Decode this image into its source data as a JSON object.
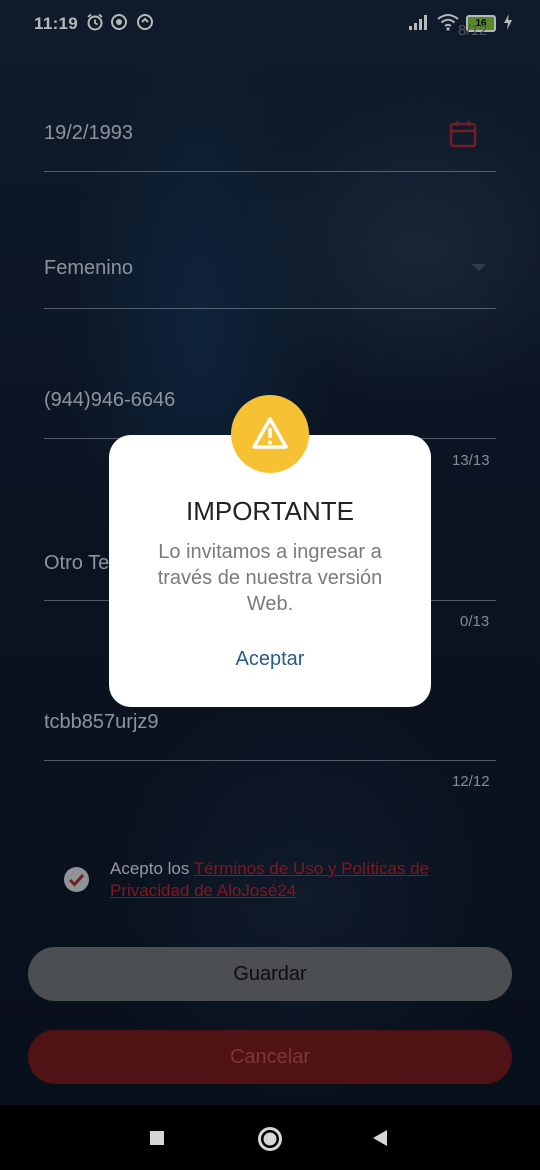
{
  "status_bar": {
    "time": "11:19",
    "battery": "16"
  },
  "form": {
    "date_value": "19/2/1993",
    "date_counter": "8/12",
    "gender_value": "Femenino",
    "phone_value": "(944)946-6646",
    "phone_counter": "13/13",
    "other_phone_value": "Otro Te",
    "other_phone_counter": "0/13",
    "code_value": "tcbb857urjz9",
    "code_counter": "12/12"
  },
  "terms": {
    "prefix": "Acepto los ",
    "link": "Términos de Uso y Políticas de Privacidad de AloJosé24"
  },
  "buttons": {
    "save": "Guardar",
    "cancel": "Cancelar"
  },
  "dialog": {
    "title": "IMPORTANTE",
    "message": "Lo invitamos a ingresar a través de nuestra versión Web.",
    "accept": "Aceptar"
  },
  "colors": {
    "accent_red": "#b6202a",
    "warning_yellow": "#f6c234",
    "link_blue": "#2b5b86"
  }
}
